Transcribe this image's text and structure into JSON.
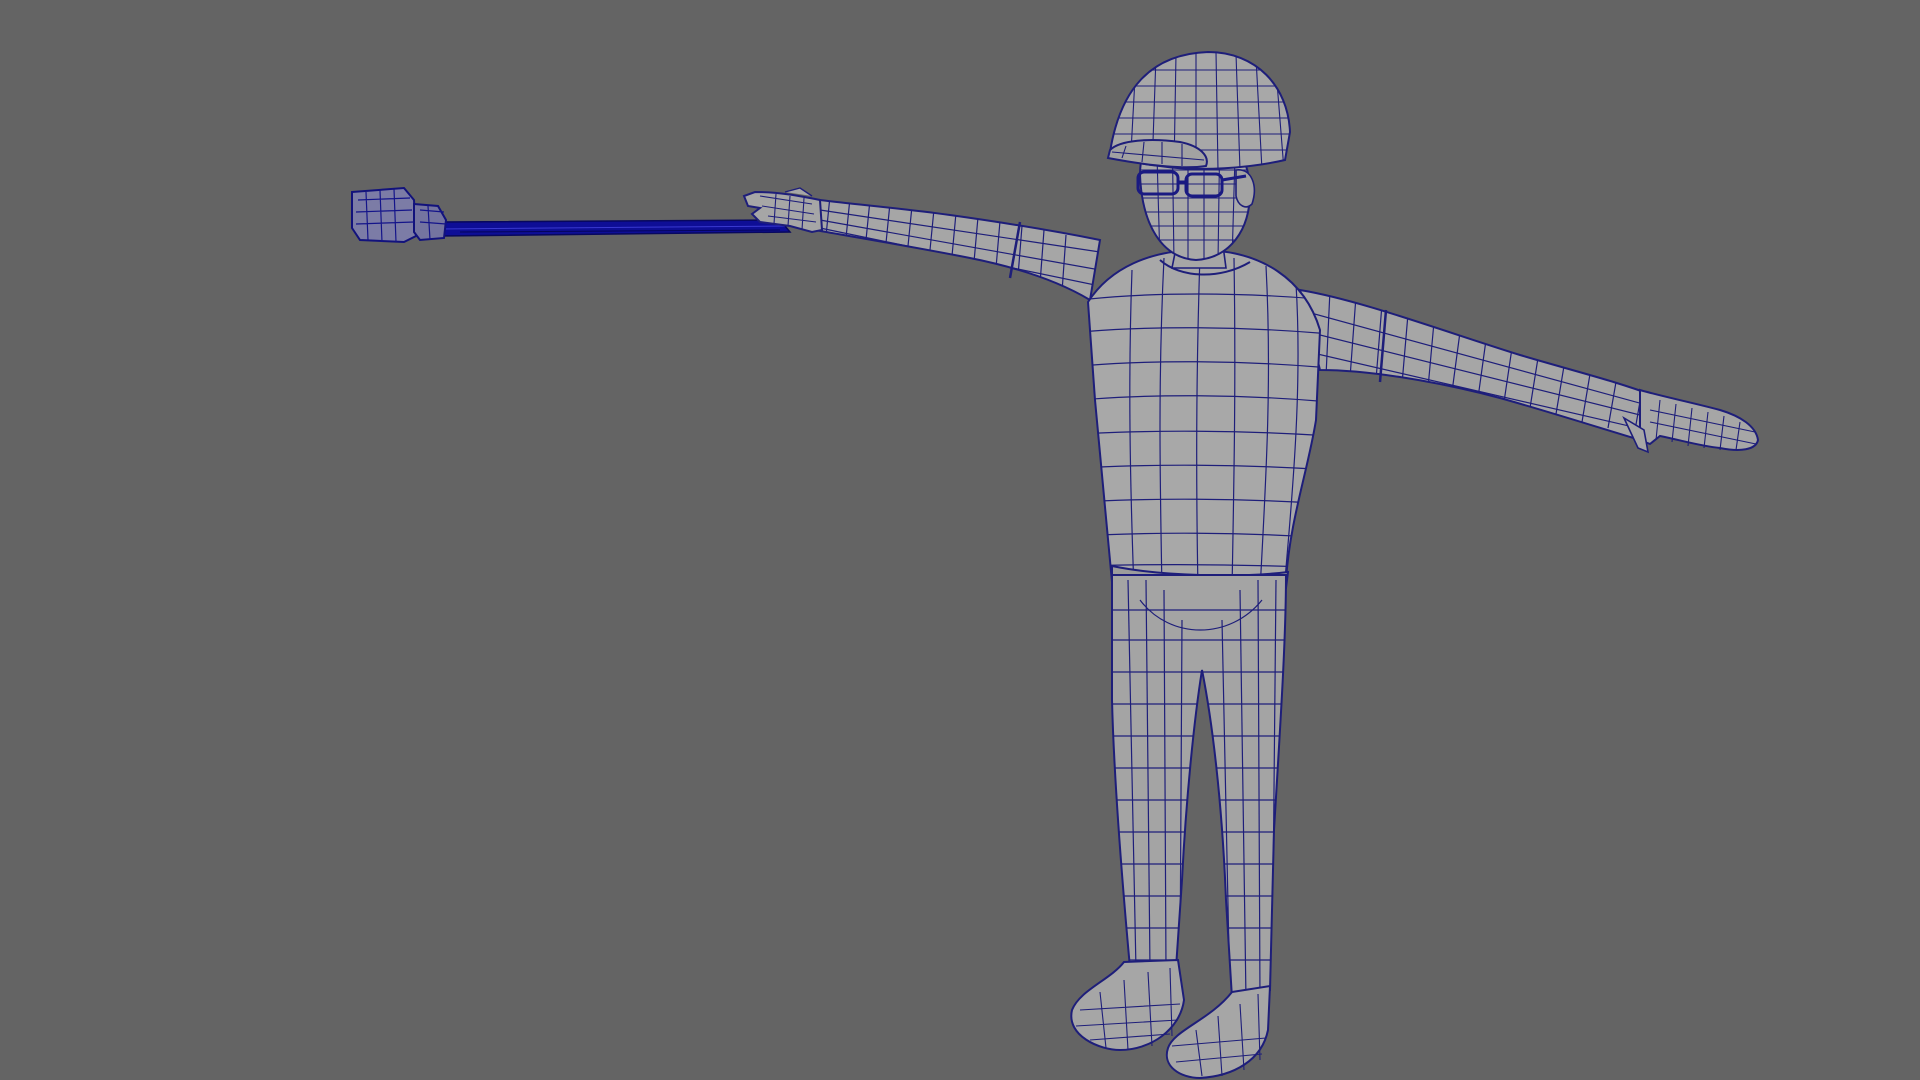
{
  "viewport": {
    "background_color": "#646464",
    "mesh_fill_color": "#a6a6a6",
    "mesh_shade_color": "#8e8e8e",
    "wireframe_color": "#1e1e7a",
    "selected_wire_color": "#0a0a8c",
    "display_mode": "wireframe-on-shaded"
  },
  "model": {
    "subject": "character-in-t-pose",
    "parts": [
      "cap",
      "head",
      "glasses",
      "torso",
      "left-arm",
      "right-arm",
      "pants",
      "left-shoe",
      "right-shoe",
      "selfie-stick",
      "camera"
    ]
  }
}
